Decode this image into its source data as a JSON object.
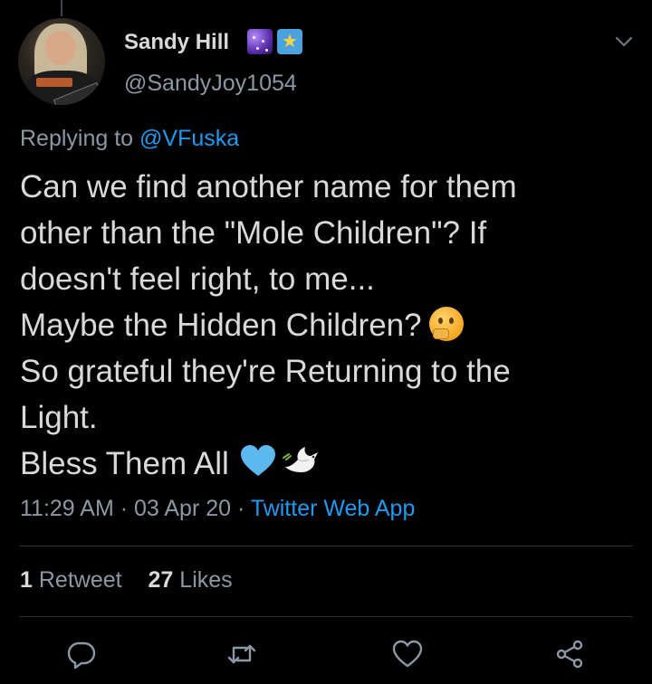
{
  "tweet": {
    "author": {
      "display_name": "Sandy Hill",
      "handle": "@SandyJoy1054",
      "badges": [
        "milky-way-emoji",
        "shooting-star-emoji"
      ]
    },
    "reply": {
      "prefix": "Replying to",
      "mention": "@VFuska"
    },
    "text_lines": [
      "Can we find another name for them",
      "other than the \"Mole Children\"? If",
      "doesn't feel right, to me...",
      "Maybe the Hidden Children?",
      "So grateful they're Returning to the",
      "Light.",
      "Bless Them All"
    ],
    "inline_emoji": {
      "line_4": "thinking-face-emoji",
      "line_7": [
        "blue-heart-emoji",
        "dove-emoji"
      ]
    },
    "meta": {
      "time": "11:29 AM",
      "sep1": " · ",
      "date": "03 Apr 20",
      "sep2": " · ",
      "source": "Twitter Web App"
    },
    "stats": {
      "retweets_count": "1",
      "retweets_label": "Retweet",
      "likes_count": "27",
      "likes_label": "Likes"
    },
    "actions": [
      "reply-icon",
      "retweet-icon",
      "like-icon",
      "share-icon"
    ]
  },
  "colors": {
    "background": "#000000",
    "text": "#d9d9d9",
    "secondary": "#8b98a5",
    "link": "#1d9bf0",
    "divider": "#2f3336"
  }
}
